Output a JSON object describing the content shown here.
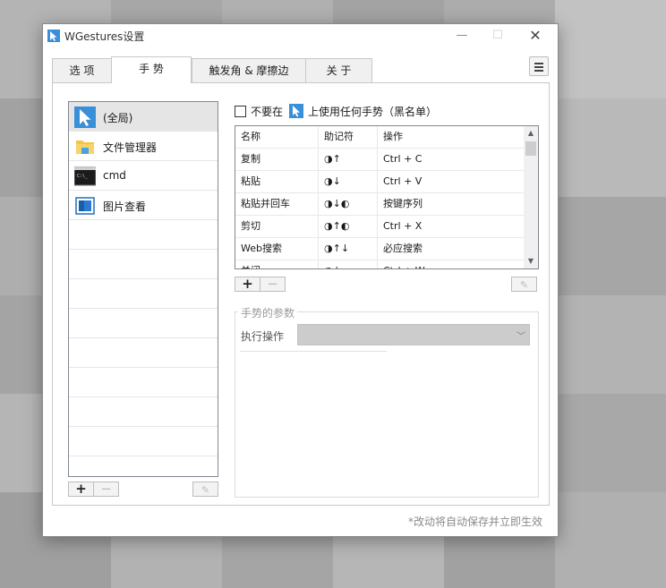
{
  "window": {
    "title": "WGestures设置"
  },
  "tabs": [
    {
      "label": "选 项"
    },
    {
      "label": "手 势"
    },
    {
      "label": "触发角 & 摩擦边"
    },
    {
      "label": "关 于"
    }
  ],
  "apps": {
    "items": [
      {
        "label": "(全局)",
        "icon": "cursor-icon"
      },
      {
        "label": "文件管理器",
        "icon": "folder-icon"
      },
      {
        "label": "cmd",
        "icon": "terminal-icon"
      },
      {
        "label": "图片查看",
        "icon": "image-viewer-icon"
      }
    ],
    "add": "+",
    "remove": "−"
  },
  "blacklist": {
    "text_before": "不要在",
    "text_after": "上使用任何手势（黑名单）"
  },
  "gestures": {
    "columns": [
      "名称",
      "助记符",
      "操作"
    ],
    "rows": [
      {
        "name": "复制",
        "mnemonic": "◑↑",
        "action": "Ctrl + C"
      },
      {
        "name": "粘贴",
        "mnemonic": "◑↓",
        "action": "Ctrl + V"
      },
      {
        "name": "粘贴并回车",
        "mnemonic": "◑↓◐",
        "action": "按键序列"
      },
      {
        "name": "剪切",
        "mnemonic": "◑↑◐",
        "action": "Ctrl + X"
      },
      {
        "name": "Web搜索",
        "mnemonic": "◑↑↓",
        "action": "必应搜索"
      },
      {
        "name": "关闭",
        "mnemonic": "◑↓→",
        "action": "Ctrl + W"
      }
    ],
    "add": "+",
    "remove": "−"
  },
  "params": {
    "title": "手势的参数",
    "exec_label": "执行操作"
  },
  "footer": {
    "note": "*改动将自动保存并立即生效"
  }
}
